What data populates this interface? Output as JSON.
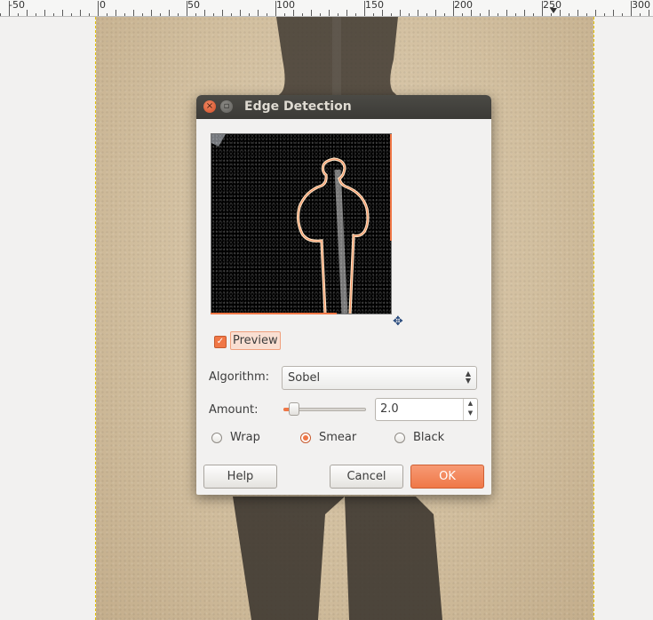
{
  "ruler": {
    "labels": [
      {
        "text": "-50"
      },
      {
        "text": "0"
      },
      {
        "text": "50"
      },
      {
        "text": "100"
      },
      {
        "text": "150"
      },
      {
        "text": "200"
      },
      {
        "text": "250"
      },
      {
        "text": "300"
      }
    ]
  },
  "dialog": {
    "title": "Edge Detection",
    "close_glyph": "×",
    "minimize_glyph": "▫",
    "preview_label": "Preview",
    "preview_checked": true,
    "algorithm_label": "Algorithm:",
    "algorithm_value": "Sobel",
    "amount_label": "Amount:",
    "amount_value": "2.0",
    "amount_fraction": 0.08,
    "edge_modes": [
      {
        "label": "Wrap",
        "selected": false
      },
      {
        "label": "Smear",
        "selected": true
      },
      {
        "label": "Black",
        "selected": false
      }
    ],
    "help_label": "Help",
    "cancel_label": "Cancel",
    "ok_label": "OK"
  },
  "icons": {
    "close": "close-icon",
    "minimize": "minimize-icon",
    "navigate": "navigate-move-icon",
    "checkbox": "checkmark-icon",
    "dropdown": "up-down-chevron-icon"
  },
  "colors": {
    "accent": "#f07746",
    "titlebar": "#3c3b37",
    "guide": "#e2c300"
  }
}
